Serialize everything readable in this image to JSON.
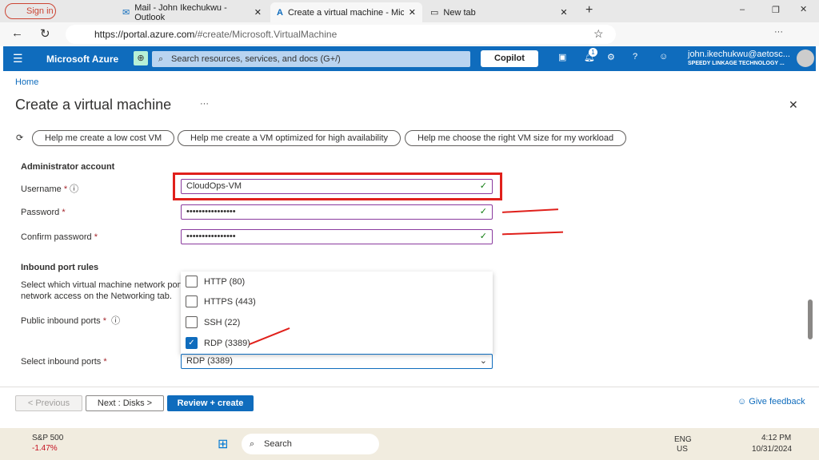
{
  "browser": {
    "sign_in": "Sign in",
    "tabs": [
      {
        "label": "Mail - John Ikechukwu - Outlook"
      },
      {
        "label": "Create a virtual machine - Microsc"
      },
      {
        "label": "New tab"
      }
    ],
    "url_host": "https://portal.azure.com",
    "url_path": "/#create/Microsoft.VirtualMachine"
  },
  "azure": {
    "brand": "Microsoft Azure",
    "search_placeholder": "Search resources, services, and docs (G+/)",
    "copilot": "Copilot",
    "notif_count": "1",
    "user": "john.ikechukwu@aetosc...",
    "org": "SPEEDY LINKAGE TECHNOLOGY ..."
  },
  "page": {
    "breadcrumb": "Home",
    "title": "Create a virtual machine",
    "more": "···",
    "help": [
      "Help me create a low cost VM",
      "Help me create a VM optimized for high availability",
      "Help me choose the right VM size for my workload"
    ],
    "admin_heading": "Administrator account",
    "username_label": "Username",
    "username": "CloudOps-VM",
    "password_label": "Password",
    "password": "••••••••••••••••",
    "confirm_label": "Confirm password",
    "confirm": "••••••••••••••••",
    "inbound_heading": "Inbound port rules",
    "inbound_desc1": "Select which virtual machine network ports",
    "inbound_desc2": "network access on the Networking tab.",
    "public_label": "Public inbound ports",
    "select_label": "Select inbound ports",
    "ports": [
      {
        "label": "HTTP (80)",
        "checked": false
      },
      {
        "label": "HTTPS (443)",
        "checked": false
      },
      {
        "label": "SSH (22)",
        "checked": false
      },
      {
        "label": "RDP (3389)",
        "checked": true
      }
    ],
    "selected_ports": "RDP (3389)"
  },
  "footer": {
    "previous": "< Previous",
    "next": "Next : Disks >",
    "review": "Review + create",
    "feedback": "Give feedback"
  },
  "taskbar": {
    "stock": "S&P 500",
    "change": "-1.47%",
    "search": "Search",
    "lang1": "ENG",
    "lang2": "US",
    "time": "4:12 PM",
    "date": "10/31/2024"
  },
  "colors": {
    "accent": "#0f6cbd",
    "annotation": "#e0201b"
  }
}
